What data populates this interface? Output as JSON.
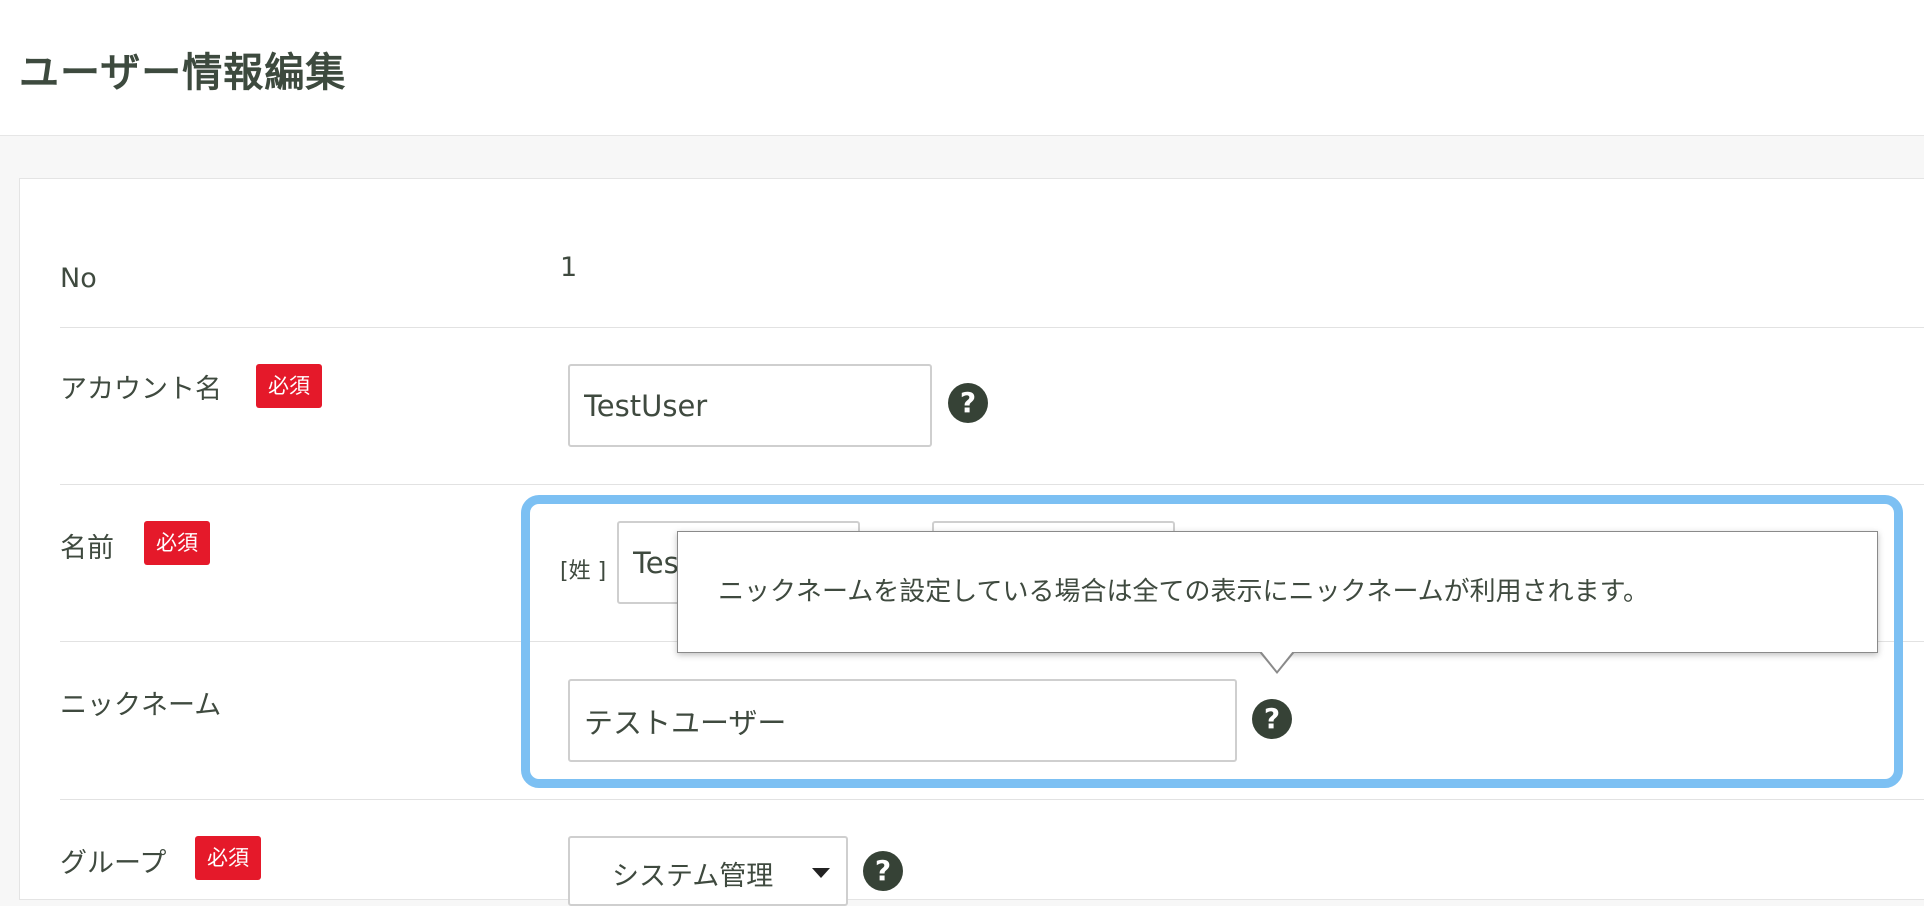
{
  "page": {
    "title": "ユーザー情報編集"
  },
  "form": {
    "no": {
      "label": "No",
      "value": "1"
    },
    "account": {
      "label": "アカウント名",
      "required": "必須",
      "value": "TestUser"
    },
    "name": {
      "label": "名前",
      "required": "必須",
      "last_name_label": "[姓 ]",
      "last_name_value": "Test",
      "first_name_value": ""
    },
    "nickname": {
      "label": "ニックネーム",
      "value": "テストユーザー"
    },
    "group": {
      "label": "グループ",
      "required": "必須",
      "selected": "システム管理"
    }
  },
  "tooltip": {
    "text": "ニックネームを設定している場合は全ての表示にニックネームが利用されます。"
  },
  "icons": {
    "help": "?"
  },
  "colors": {
    "required_badge": "#e5192a",
    "highlight": "#7cc0f3",
    "help_icon": "#364236"
  }
}
